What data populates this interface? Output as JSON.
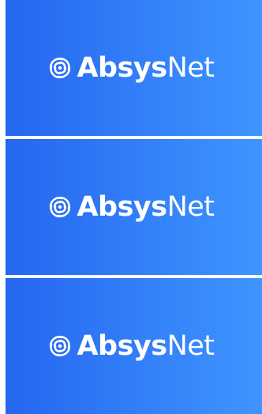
{
  "brand": {
    "name_bold": "Absys",
    "name_light": "Net",
    "logo_icon": "swirl-logo-icon",
    "text_color": "#ffffff",
    "gradient_start": "#2566f0",
    "gradient_end": "#3f95ff"
  },
  "banners": [
    {
      "name_bold": "Absys",
      "name_light": "Net"
    },
    {
      "name_bold": "Absys",
      "name_light": "Net"
    },
    {
      "name_bold": "Absys",
      "name_light": "Net"
    }
  ]
}
